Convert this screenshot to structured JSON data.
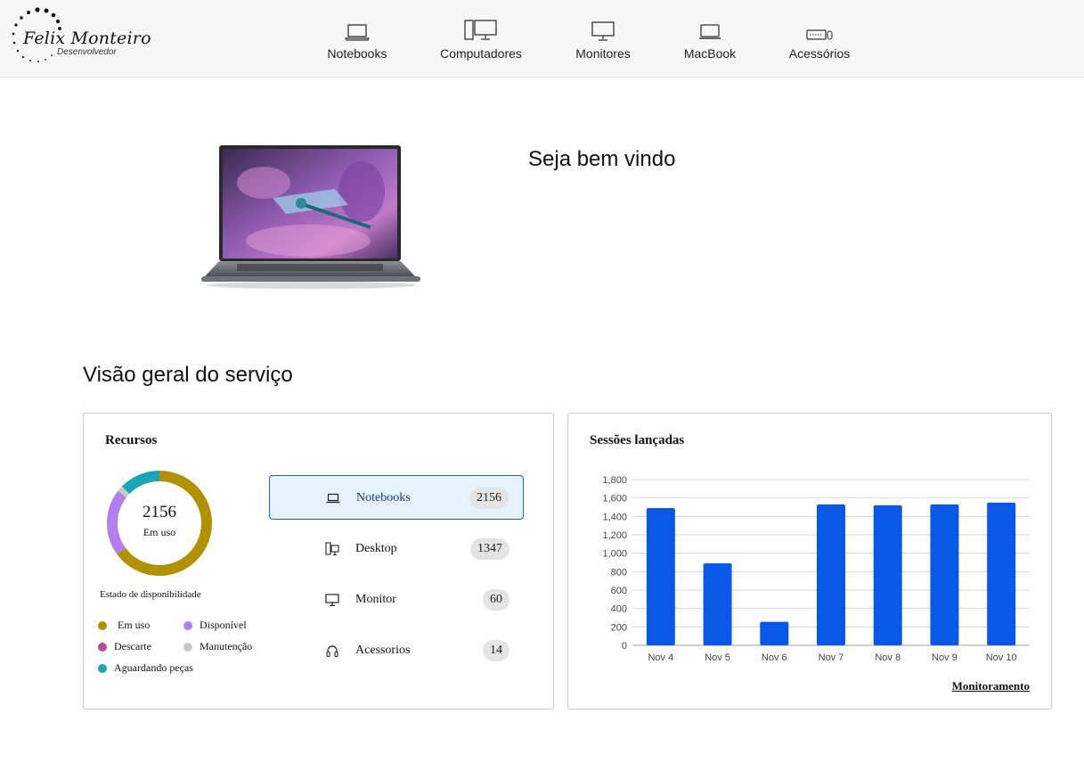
{
  "logo": {
    "name": "Felix Monteiro",
    "subtitle": "Desenvolvedor"
  },
  "nav": {
    "items": [
      {
        "label": "Notebooks",
        "icon": "laptop-icon"
      },
      {
        "label": "Computadores",
        "icon": "desktop-computer-icon"
      },
      {
        "label": "Monitores",
        "icon": "monitor-icon"
      },
      {
        "label": "MacBook",
        "icon": "macbook-icon"
      },
      {
        "label": "Acessórios",
        "icon": "keyboard-mouse-icon"
      }
    ]
  },
  "hero": {
    "welcome": "Seja bem vindo",
    "image": "laptop-product-image"
  },
  "overview": {
    "title": "Visão geral do serviço"
  },
  "resources": {
    "title": "Recursos",
    "donut": {
      "value": "2156",
      "label": "Em uso",
      "segments": [
        {
          "name": "Em uso",
          "value": 2156,
          "color": "#b29100"
        },
        {
          "name": "Disponível",
          "value": 680,
          "color": "#b27ef0"
        },
        {
          "name": "Manutenção",
          "value": 60,
          "color": "#c8c8c8"
        },
        {
          "name": "Aguardando peças",
          "value": 420,
          "color": "#1ba6b8"
        }
      ]
    },
    "availability_title": "Estado de disponibilidade",
    "legend": [
      {
        "label": "Em uso",
        "color": "#b29100"
      },
      {
        "label": "Disponível",
        "color": "#b27ef0"
      },
      {
        "label": "Descarte",
        "color": "#b6479d"
      },
      {
        "label": "Manutenção",
        "color": "#c8c8c8"
      },
      {
        "label": "Aguardando peças",
        "color": "#1ba6b8"
      }
    ],
    "rows": [
      {
        "label": "Notebooks",
        "count": "2156",
        "icon": "laptop-icon",
        "active": true
      },
      {
        "label": "Desktop",
        "count": "1347",
        "icon": "desktop-icon",
        "active": false
      },
      {
        "label": "Monitor",
        "count": "60",
        "icon": "monitor-icon",
        "active": false
      },
      {
        "label": "Acessorios",
        "count": "14",
        "icon": "headset-icon",
        "active": false
      }
    ]
  },
  "sessions": {
    "title": "Sessões lançadas",
    "link": "Monitoramento"
  },
  "chart_data": {
    "type": "bar",
    "title": "Sessões lançadas",
    "xlabel": "",
    "ylabel": "",
    "categories": [
      "Nov 4",
      "Nov 5",
      "Nov 6",
      "Nov 7",
      "Nov 8",
      "Nov 9",
      "Nov 10"
    ],
    "values": [
      1490,
      890,
      255,
      1530,
      1520,
      1530,
      1550
    ],
    "ylim": [
      0,
      1800
    ],
    "yticks": [
      0,
      200,
      400,
      600,
      800,
      1000,
      1200,
      1400,
      1600,
      1800
    ],
    "ytick_labels": [
      "0",
      "200",
      "400",
      "600",
      "800",
      "1,000",
      "1,200",
      "1,400",
      "1,600",
      "1,800"
    ],
    "color": "#0a59e6",
    "grid": true,
    "legend": "none"
  }
}
